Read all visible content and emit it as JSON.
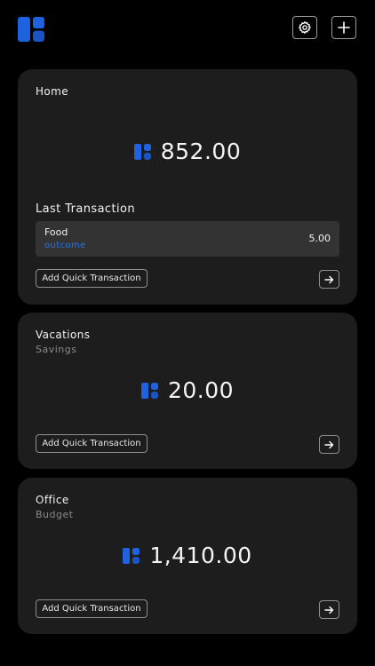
{
  "colors": {
    "background": "#000000",
    "card": "#1d1d1d",
    "accent": "#1f62e0",
    "transaction_row": "#333333",
    "outcome_text": "#2a74e8"
  },
  "header": {
    "logo_icon": "app-logo-icon",
    "settings_icon": "gear-icon",
    "add_icon": "plus-icon"
  },
  "accounts": [
    {
      "name": "Home",
      "type": "",
      "balance": "852.00",
      "last_transaction_title": "Last Transaction",
      "last_transaction": {
        "name": "Food",
        "kind": "outcome",
        "amount": "5.00"
      },
      "quick_label": "Add Quick Transaction"
    },
    {
      "name": "Vacations",
      "type": "Savings",
      "balance": "20.00",
      "quick_label": "Add Quick Transaction"
    },
    {
      "name": "Office",
      "type": "Budget",
      "balance": "1,410.00",
      "quick_label": "Add Quick Transaction"
    }
  ]
}
